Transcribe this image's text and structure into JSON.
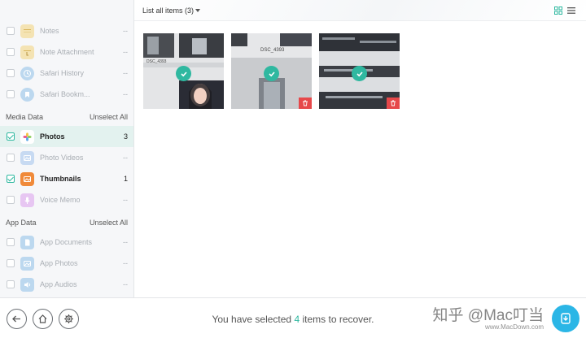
{
  "sidebar": {
    "items_top": [
      {
        "label": "Notes",
        "count": "--",
        "icon": "notes-icon",
        "color": "#f4e3b3"
      },
      {
        "label": "Note Attachment",
        "count": "--",
        "icon": "note-attachment-icon",
        "color": "#f4e3b3"
      },
      {
        "label": "Safari History",
        "count": "--",
        "icon": "safari-history-icon",
        "color": "#bcd8ef"
      },
      {
        "label": "Safari Bookm...",
        "count": "--",
        "icon": "safari-bookmark-icon",
        "color": "#bcd8ef"
      }
    ],
    "media_section": {
      "title": "Media Data",
      "action": "Unselect All"
    },
    "media_items": [
      {
        "label": "Photos",
        "count": "3",
        "icon": "photos-icon",
        "color": "#ffffff",
        "checked": true,
        "selected": true
      },
      {
        "label": "Photo Videos",
        "count": "--",
        "icon": "photo-videos-icon",
        "color": "#c7daf2",
        "checked": false,
        "selected": false
      },
      {
        "label": "Thumbnails",
        "count": "1",
        "icon": "thumbnails-icon",
        "color": "#f08a3a",
        "checked": true,
        "selected": false
      },
      {
        "label": "Voice Memo",
        "count": "--",
        "icon": "voice-memo-icon",
        "color": "#e7c6f2",
        "checked": false,
        "selected": false
      }
    ],
    "app_section": {
      "title": "App Data",
      "action": "Unselect All"
    },
    "app_items": [
      {
        "label": "App Documents",
        "count": "--",
        "icon": "app-documents-icon",
        "color": "#bcd8ef"
      },
      {
        "label": "App Photos",
        "count": "--",
        "icon": "app-photos-icon",
        "color": "#bcd8ef"
      },
      {
        "label": "App Audios",
        "count": "--",
        "icon": "app-audios-icon",
        "color": "#bcd8ef"
      }
    ]
  },
  "toolbar": {
    "filter_label": "List all items (3)"
  },
  "thumbnails": [
    {
      "caption": "DSC_4393",
      "checked": true,
      "has_trash": false
    },
    {
      "caption": "DSC_4393",
      "checked": true,
      "has_trash": true
    },
    {
      "caption": "",
      "checked": true,
      "has_trash": true
    }
  ],
  "footer": {
    "status_prefix": "You have selected",
    "status_count": "4",
    "status_suffix": "items to recover.",
    "watermark": "知乎 @Mac叮当",
    "watermark_sub": "www.MacDown.com"
  },
  "colors": {
    "accent": "#2fb8a0",
    "recover": "#2bb6e6",
    "trash": "#e6484a"
  }
}
